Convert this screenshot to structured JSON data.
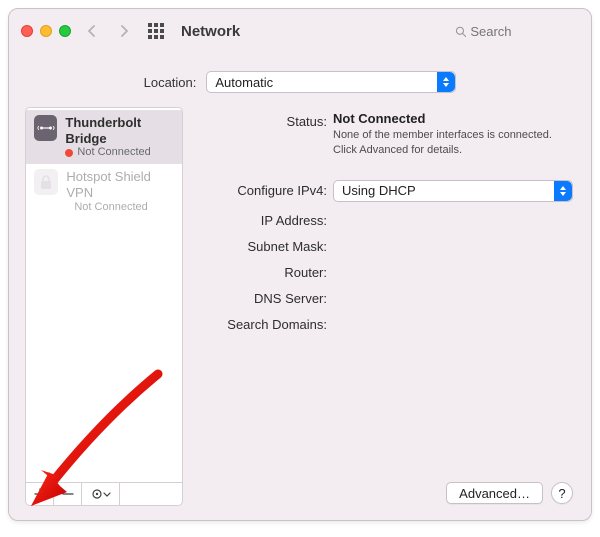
{
  "window": {
    "title": "Network"
  },
  "search": {
    "placeholder": "Search"
  },
  "location": {
    "label": "Location:",
    "value": "Automatic"
  },
  "sidebar": {
    "services": [
      {
        "name": "Thunderbolt Bridge",
        "status": "Not Connected",
        "icon": "thunderbolt-icon",
        "selected": true
      },
      {
        "name": "Hotspot Shield VPN",
        "status": "Not Connected",
        "icon": "lock-icon",
        "selected": false
      }
    ]
  },
  "details": {
    "status_label": "Status:",
    "status_value": "Not Connected",
    "status_hint": "None of the member interfaces is connected. Click Advanced for details.",
    "config_label": "Configure IPv4:",
    "config_value": "Using DHCP",
    "ip_label": "IP Address:",
    "subnet_label": "Subnet Mask:",
    "router_label": "Router:",
    "dns_label": "DNS Server:",
    "search_label": "Search Domains:"
  },
  "actions": {
    "advanced": "Advanced…",
    "help": "?"
  },
  "colors": {
    "accent": "#0a7aff",
    "status_bad": "#f24937"
  }
}
